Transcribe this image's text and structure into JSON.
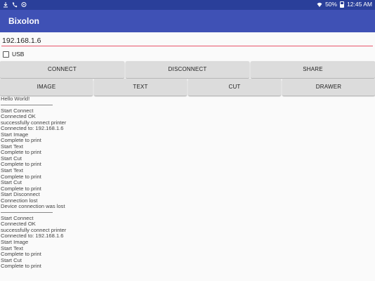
{
  "status_bar": {
    "left_icons": [
      "samsung-icon",
      "phone-icon",
      "circle-icon"
    ],
    "battery": "50%",
    "time": "12:45 AM"
  },
  "app": {
    "title": "Bixolon"
  },
  "ip_field": {
    "value": "192.168.1.6"
  },
  "usb_checkbox": {
    "label": "USB",
    "checked": false
  },
  "buttons_row1": {
    "connect": "CONNECT",
    "disconnect": "DISCONNECT",
    "share": "SHARE"
  },
  "buttons_row2": {
    "image": "IMAGE",
    "text": "TEXT",
    "cut": "CUT",
    "drawer": "DRAWER"
  },
  "log": {
    "hello": "Hello World!",
    "section1": [
      "Start Connect",
      "Connected OK",
      "successfully connect printer",
      "Connected to: 192.168.1.6",
      "Start Image",
      "Complete to print",
      "Start Text",
      "Complete to print",
      "Start Cut",
      "Complete to print",
      "Start Text",
      "Complete to print",
      "Start Cut",
      "Complete to print",
      "Start Disconnect",
      "Connection lost",
      "Device connection was lost"
    ],
    "section2": [
      "Start Connect",
      "Connected OK",
      "successfully connect printer",
      "Connected to: 192.168.1.6",
      "Start Image",
      "Start Text",
      "Complete to print",
      "Start Cut",
      "Complete to print"
    ]
  }
}
